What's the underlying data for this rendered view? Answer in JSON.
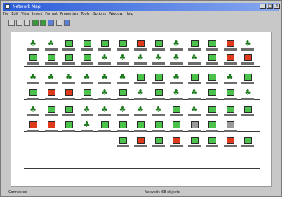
{
  "window": {
    "title": "Network Map",
    "close": "✕",
    "min": "–",
    "max": "□"
  },
  "menu": [
    "File",
    "Edit",
    "View",
    "Insert",
    "Format",
    "Properties",
    "Tools",
    "Options",
    "Window",
    "Help"
  ],
  "toolbar": [
    "new",
    "open",
    "save",
    "print",
    "connect",
    "disconnect",
    "zoom",
    "refresh"
  ],
  "rows": [
    [
      "g-f",
      "g-f",
      "g",
      "g",
      "g",
      "g",
      "r",
      "g",
      "g-f",
      "g",
      "g",
      "r",
      "g-f"
    ],
    [
      "g",
      "g",
      "g",
      "g",
      "g-f",
      "g-f",
      "g-f",
      "g-f",
      "g-f",
      "g-f",
      "g",
      "r",
      "r"
    ],
    [
      "g-f",
      "g-f",
      "g-f",
      "g-f",
      "g-f",
      "g-f",
      "g",
      "g",
      "g-f",
      "g",
      "g",
      "g-f",
      "g"
    ],
    [
      "g",
      "r",
      "r",
      "g",
      "g-f",
      "g",
      "g-f",
      "g",
      "g-f",
      "g-f",
      "g",
      "g",
      "g-f"
    ],
    [
      "g-f",
      "g",
      "g",
      "g-f",
      "g-f",
      "g-f",
      "g-f",
      "g-f",
      "g",
      "g-f",
      "g",
      "g",
      "g"
    ],
    [
      "r",
      "r",
      "g",
      "g-f",
      "g",
      "g",
      "g",
      "g",
      "g",
      "gray",
      "g",
      "gray",
      ""
    ],
    [
      "",
      "",
      "",
      "",
      "",
      "g",
      "r",
      "g",
      "r",
      "g",
      "g",
      "r",
      "g"
    ]
  ],
  "status": {
    "left": "Connected",
    "center": "Network: 68 objects"
  }
}
